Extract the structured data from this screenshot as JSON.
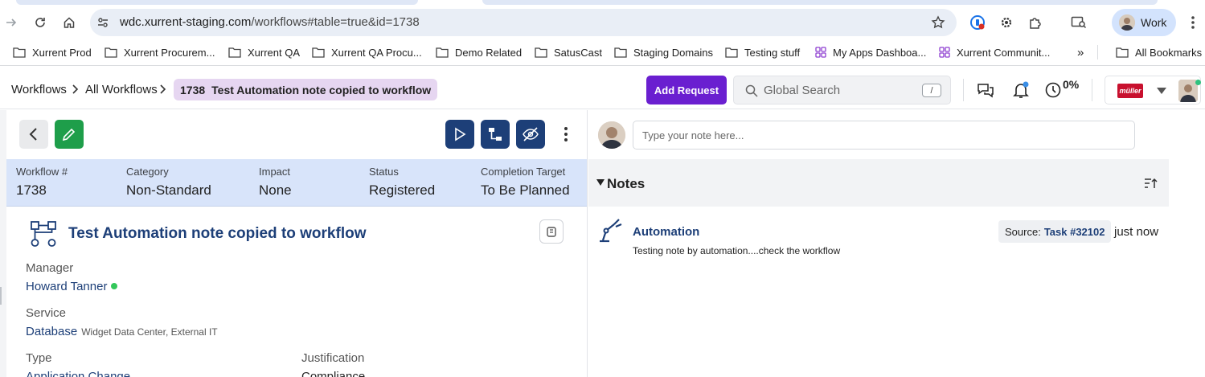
{
  "browser": {
    "url_host": "wdc.xurrent-staging.com",
    "url_path": "/workflows#table=true&id=1738",
    "profile_label": "Work",
    "bookmarks": [
      {
        "label": "Xurrent Prod",
        "icon": "folder-icon"
      },
      {
        "label": "Xurrent Procurem...",
        "icon": "folder-icon"
      },
      {
        "label": "Xurrent QA",
        "icon": "folder-icon"
      },
      {
        "label": "Xurrent QA Procu...",
        "icon": "folder-icon"
      },
      {
        "label": "Demo Related",
        "icon": "folder-icon"
      },
      {
        "label": "SatusCast",
        "icon": "folder-icon"
      },
      {
        "label": "Staging Domains",
        "icon": "folder-icon"
      },
      {
        "label": "Testing stuff",
        "icon": "folder-icon"
      },
      {
        "label": "My Apps Dashboa...",
        "icon": "app-grid-icon"
      },
      {
        "label": "Xurrent Communit...",
        "icon": "app-grid-icon"
      }
    ],
    "more_bookmarks": "»",
    "all_bookmarks": "All Bookmarks"
  },
  "header": {
    "breadcrumb": [
      "Workflows",
      "All Workflows"
    ],
    "current_id": "1738",
    "current_title": "Test Automation note copied to workflow",
    "add_request": "Add Request",
    "search_placeholder": "Global Search",
    "search_shortcut": "/",
    "progress_percent": "0%",
    "account_logo_text": "müller"
  },
  "summary": [
    {
      "label": "Workflow #",
      "value": "1738"
    },
    {
      "label": "Category",
      "value": "Non-Standard"
    },
    {
      "label": "Impact",
      "value": "None"
    },
    {
      "label": "Status",
      "value": "Registered"
    },
    {
      "label": "Completion Target",
      "value": "To Be Planned"
    }
  ],
  "workflow": {
    "title": "Test Automation note copied to workflow",
    "manager_label": "Manager",
    "manager": "Howard Tanner",
    "service_label": "Service",
    "service": "Database",
    "service_detail": "Widget Data Center, External IT",
    "type_label": "Type",
    "type": "Application Change",
    "justification_label": "Justification",
    "justification": "Compliance"
  },
  "notes": {
    "input_placeholder": "Type your note here...",
    "section_title": "Notes",
    "items": [
      {
        "author": "Automation",
        "text": "Testing note by automation....check the workflow",
        "source_label": "Source:",
        "source_link": "Task #32102",
        "time": "just now"
      }
    ]
  },
  "colors": {
    "primary": "#6a1fd0",
    "navy": "#1d3f78",
    "summary_bg": "#d8e4fa",
    "edit_green": "#1e9e4a",
    "breadcrumb_chip": "#e6d6f1"
  }
}
